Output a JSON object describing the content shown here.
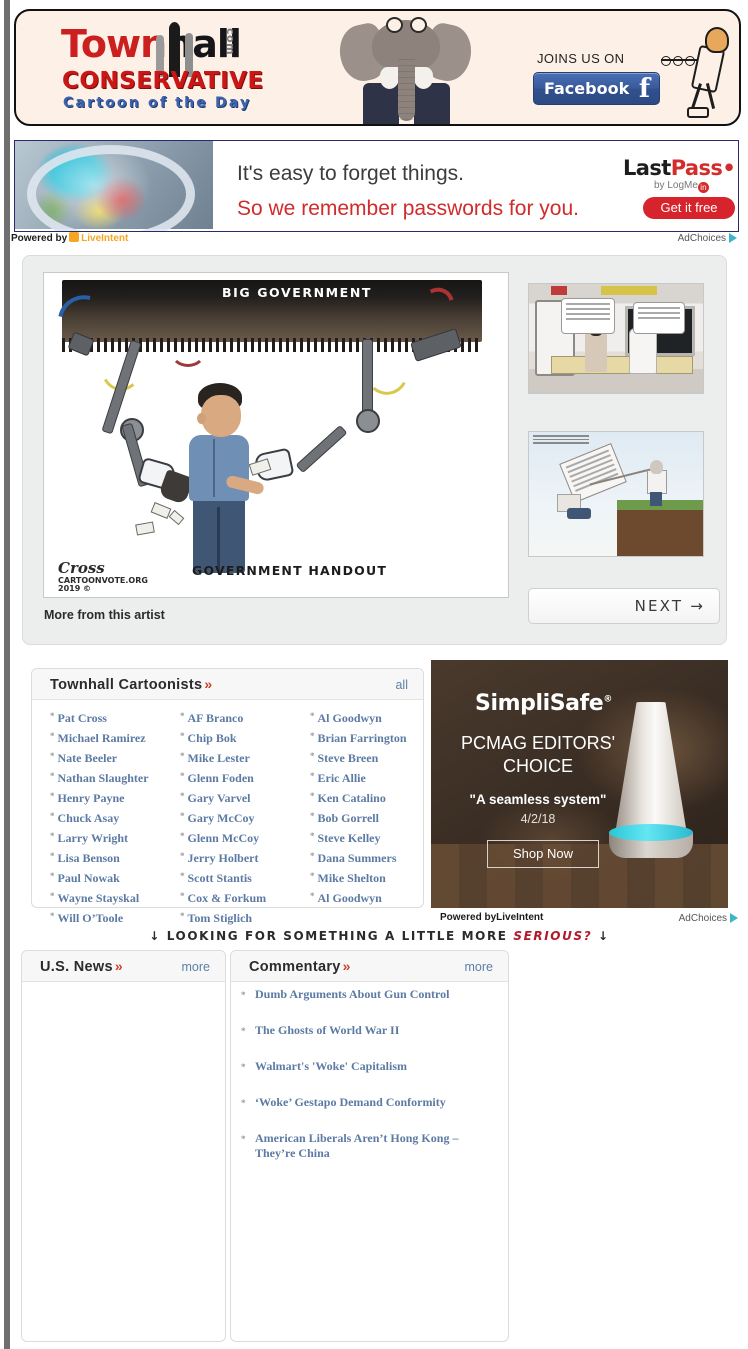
{
  "header": {
    "logo": {
      "town": "Town",
      "hall": "hall",
      "com": "com",
      "tagline1": "CONSERVATIVE",
      "tagline2": "Cartoon of the Day"
    },
    "social": {
      "joins_label": "JOINS US ON",
      "facebook_label": "Facebook",
      "facebook_glyph": "f"
    }
  },
  "lastpass_ad": {
    "line1": "It's easy to forget things.",
    "line2": "So we remember passwords for you.",
    "brand_last": "Last",
    "brand_pass": "Pass",
    "brand_dots": "•••|",
    "brand_sub": "by LogMe",
    "brand_sub_badge": "in",
    "cta": "Get it free"
  },
  "powered": {
    "prefix": "Powered by",
    "network": "LiveIntent",
    "adchoices": "AdChoices"
  },
  "viewer": {
    "cartoon": {
      "machine_label": "BIG GOVERNMENT",
      "caption": "GOVERNMENT HANDOUT",
      "signature_site": "CARTOONVOTE.ORG",
      "signature_year": "2019 ©",
      "signature_mark": "Cross"
    },
    "more_from_artist": "More from this artist",
    "next_label": "NEXT",
    "next_arrow": "→"
  },
  "cartoonists": {
    "title": "Townhall Cartoonists",
    "chevron": "»",
    "all_label": "all",
    "columns": [
      [
        "Pat Cross",
        "Michael Ramirez",
        "Nate Beeler",
        "Nathan Slaughter",
        "Henry Payne",
        "Chuck Asay",
        "Larry Wright",
        "Lisa Benson",
        "Paul Nowak",
        "Wayne Stayskal",
        "Will O’Toole"
      ],
      [
        "AF Branco",
        "Chip Bok",
        "Mike Lester",
        "Glenn Foden",
        "Gary Varvel",
        "Gary McCoy",
        "Glenn McCoy",
        "Jerry Holbert",
        "Scott Stantis",
        "Cox & Forkum",
        "Tom Stiglich"
      ],
      [
        "Al Goodwyn",
        "Brian Farrington",
        "Steve Breen",
        "Eric Allie",
        "Ken Catalino",
        "Bob Gorrell",
        "Steve Kelley",
        "Dana Summers",
        "Mike Shelton",
        "Al Goodwyn"
      ]
    ],
    "bullet": "*"
  },
  "simplisafe_ad": {
    "brand": "SimpliSafe",
    "brand_tm": "®",
    "headline": "PCMAG EDITORS' CHOICE",
    "quote": "\"A seamless system\"",
    "date": "4/2/18",
    "cta": "Shop Now"
  },
  "serious_banner": {
    "arrow_left": "↓",
    "text": "LOOKING FOR SOMETHING A LITTLE MORE",
    "highlight": "SERIOUS?",
    "arrow_right": "↓"
  },
  "news_panel": {
    "title": "U.S. News",
    "chevron": "»",
    "more_label": "more",
    "items": []
  },
  "commentary_panel": {
    "title": "Commentary",
    "chevron": "»",
    "more_label": "more",
    "bullet": "*",
    "items": [
      "Dumb Arguments About Gun Control",
      "The Ghosts of World War II",
      "Walmart's 'Woke' Capitalism",
      "‘Woke’ Gestapo Demand Conformity",
      "American Liberals Aren’t Hong Kong – They’re China"
    ]
  },
  "colors": {
    "brand_red": "#cc1f1f",
    "brand_blue": "#3c63ad",
    "link_blue": "#5c7aa3",
    "accent_orange": "#c9432c",
    "lastpass_red": "#d42b2b",
    "facebook_blue": "#3a5b9c"
  }
}
